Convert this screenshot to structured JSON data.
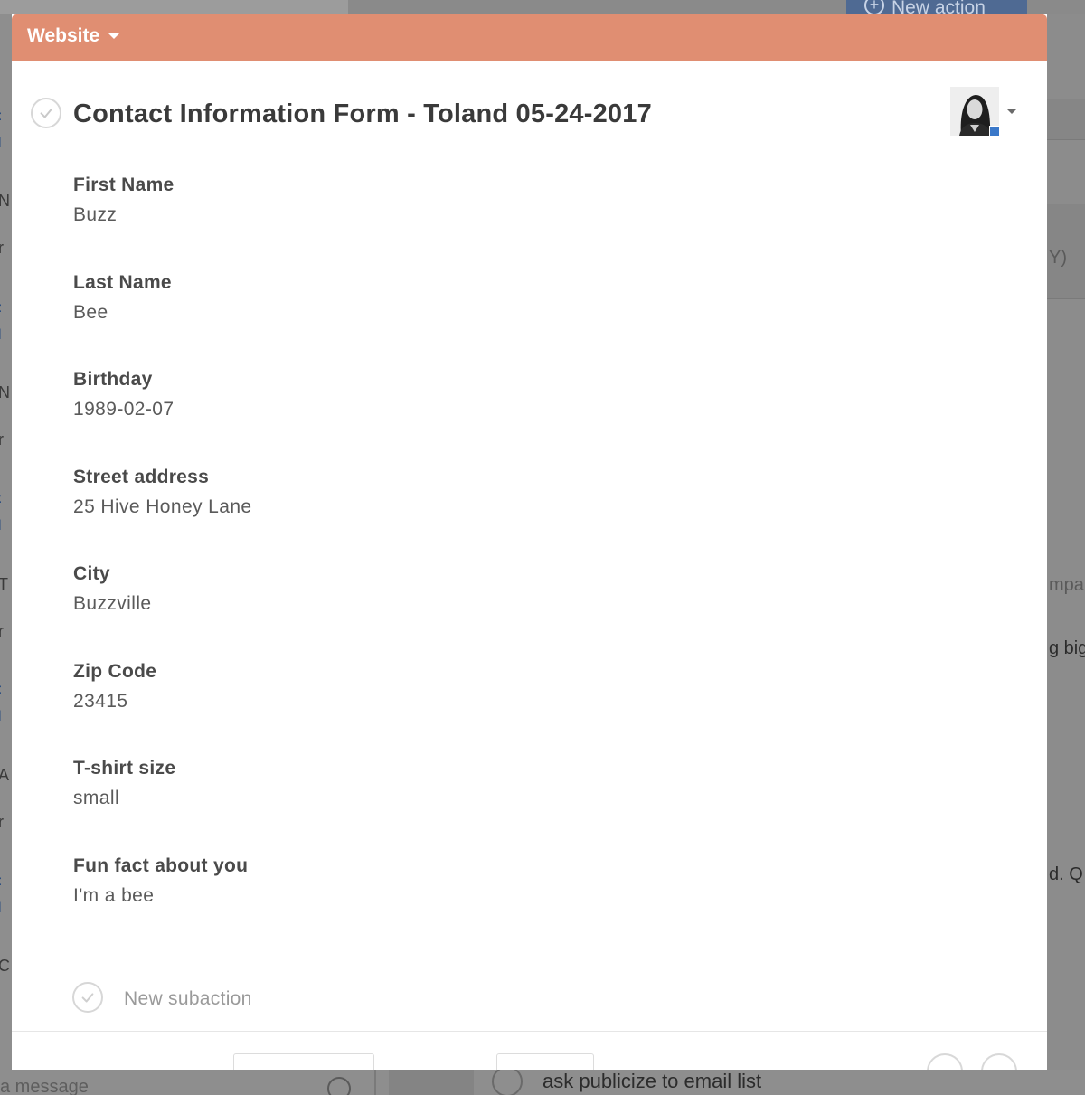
{
  "background": {
    "new_action_label": "New action",
    "right_fragments": [
      "Y)",
      "mpa",
      "g big",
      "d. Q"
    ],
    "message_placeholder": "a message",
    "task_text": "ask publicize to email list"
  },
  "modal": {
    "header": {
      "category_label": "Website",
      "color": "#e08e72"
    },
    "title": "Contact Information Form - Toland 05-24-2017",
    "fields": [
      {
        "label": "First Name",
        "value": "Buzz"
      },
      {
        "label": "Last Name",
        "value": "Bee"
      },
      {
        "label": "Birthday",
        "value": "1989-02-07"
      },
      {
        "label": "Street address",
        "value": "25 Hive Honey Lane"
      },
      {
        "label": "City",
        "value": "Buzzville"
      },
      {
        "label": "Zip Code",
        "value": "23415"
      },
      {
        "label": "T-shirt size",
        "value": "small"
      },
      {
        "label": "Fun fact about you",
        "value": "I'm a bee"
      }
    ],
    "subaction_placeholder": "New subaction"
  }
}
